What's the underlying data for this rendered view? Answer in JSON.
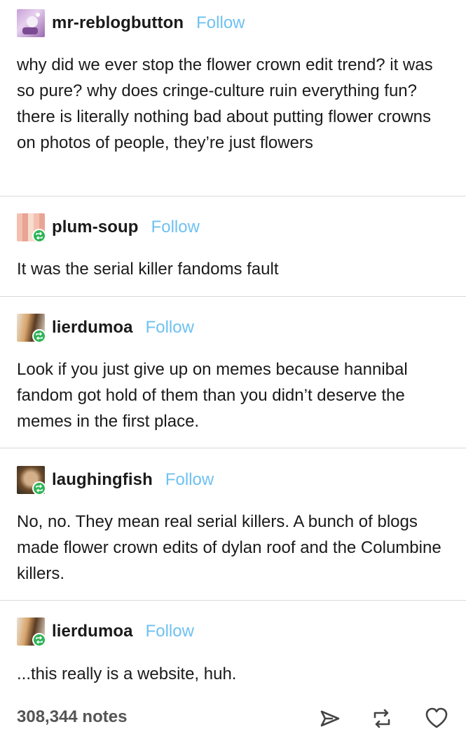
{
  "posts": [
    {
      "username": "mr-reblogbutton",
      "follow_label": "Follow",
      "text": "why did we ever stop the flower crown edit trend? it was so pure? why does cringe-culture ruin everything fun? there is literally nothing bad about putting flower crowns on photos of people, they’re just flowers"
    },
    {
      "username": "plum-soup",
      "follow_label": "Follow",
      "text": "It was the serial killer fandoms fault"
    },
    {
      "username": "lierdumoa",
      "follow_label": "Follow",
      "text": "Look if you just give up on memes because hannibal fandom got hold of them than you didn’t deserve the memes in the first place."
    },
    {
      "username": "laughingfish",
      "follow_label": "Follow",
      "text": "No, no. They mean real serial killers. A bunch of blogs made flower crown edits of dylan roof and the Columbine killers."
    },
    {
      "username": "lierdumoa",
      "follow_label": "Follow",
      "text": "...this really is a website, huh."
    }
  ],
  "footer": {
    "notes": "308,344 notes",
    "icons": [
      "share-icon",
      "reblog-icon",
      "like-icon"
    ]
  },
  "colors": {
    "follow": "#6ec1f2",
    "reblog_badge": "#2fb457",
    "divider": "#d9d9d9"
  }
}
